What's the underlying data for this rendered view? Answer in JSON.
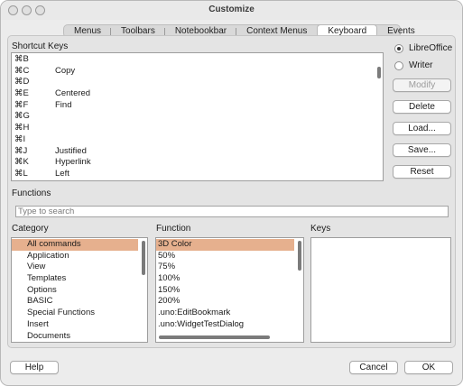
{
  "window": {
    "title": "Customize"
  },
  "tabs": [
    {
      "label": "Menus"
    },
    {
      "label": "Toolbars"
    },
    {
      "label": "Notebookbar"
    },
    {
      "label": "Context Menus"
    },
    {
      "label": "Keyboard",
      "active": true
    },
    {
      "label": "Events"
    }
  ],
  "shortcut_keys": {
    "label": "Shortcut Keys",
    "rows": [
      {
        "key": "⌘B",
        "command": ""
      },
      {
        "key": "⌘C",
        "command": "Copy"
      },
      {
        "key": "⌘D",
        "command": ""
      },
      {
        "key": "⌘E",
        "command": "Centered"
      },
      {
        "key": "⌘F",
        "command": "Find"
      },
      {
        "key": "⌘G",
        "command": ""
      },
      {
        "key": "⌘H",
        "command": ""
      },
      {
        "key": "⌘I",
        "command": ""
      },
      {
        "key": "⌘J",
        "command": "Justified"
      },
      {
        "key": "⌘K",
        "command": "Hyperlink"
      },
      {
        "key": "⌘L",
        "command": "Left"
      }
    ]
  },
  "scope": {
    "options": [
      {
        "label": "LibreOffice",
        "selected": true
      },
      {
        "label": "Writer",
        "selected": false
      }
    ]
  },
  "side_buttons": {
    "modify": "Modify",
    "delete": "Delete",
    "load": "Load...",
    "save": "Save...",
    "reset": "Reset"
  },
  "functions": {
    "label": "Functions",
    "search_placeholder": "Type to search"
  },
  "category": {
    "label": "Category",
    "items": [
      "All commands",
      "Application",
      "View",
      "Templates",
      "Options",
      "BASIC",
      "Special Functions",
      "Insert",
      "Documents"
    ],
    "selected_index": 0
  },
  "function": {
    "label": "Function",
    "items": [
      "3D Color",
      "50%",
      "75%",
      "100%",
      "150%",
      "200%",
      ".uno:EditBookmark",
      ".uno:WidgetTestDialog"
    ],
    "selected_index": 0
  },
  "keys": {
    "label": "Keys"
  },
  "footer": {
    "help": "Help",
    "cancel": "Cancel",
    "ok": "OK"
  },
  "colors": {
    "selection": "#e6b08e",
    "window_bg": "#ececec"
  }
}
